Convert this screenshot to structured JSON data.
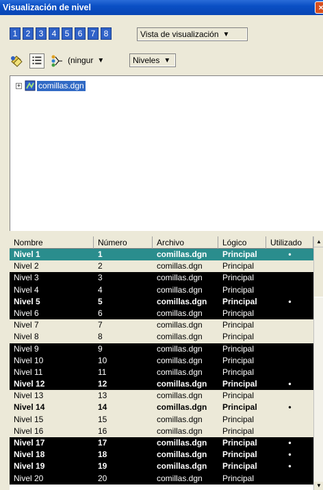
{
  "window": {
    "title": "Visualización de nivel",
    "close_glyph": "×"
  },
  "toolbar1": {
    "view_numbers": [
      "1",
      "2",
      "3",
      "4",
      "5",
      "6",
      "7",
      "8"
    ],
    "view_dropdown": "Vista de visualización"
  },
  "toolbar2": {
    "icons": [
      "level-manager-icon",
      "list-view-icon",
      "filter-icon"
    ],
    "filter_dropdown": "(ningur",
    "levels_dropdown": "Niveles"
  },
  "tree": {
    "file": "comillas.dgn"
  },
  "table": {
    "columns": [
      "Nombre",
      "Número",
      "Archivo",
      "Lógico",
      "Utilizado"
    ],
    "rows": [
      {
        "name": "Nivel 1",
        "num": "1",
        "file": "comillas.dgn",
        "logic": "Principal",
        "used": "•",
        "style": "teal",
        "bold": true
      },
      {
        "name": "Nivel 2",
        "num": "2",
        "file": "comillas.dgn",
        "logic": "Principal",
        "used": "",
        "style": "light",
        "bold": false
      },
      {
        "name": "Nivel 3",
        "num": "3",
        "file": "comillas.dgn",
        "logic": "Principal",
        "used": "",
        "style": "dark",
        "bold": false
      },
      {
        "name": "Nivel 4",
        "num": "4",
        "file": "comillas.dgn",
        "logic": "Principal",
        "used": "",
        "style": "dark",
        "bold": false
      },
      {
        "name": "Nivel 5",
        "num": "5",
        "file": "comillas.dgn",
        "logic": "Principal",
        "used": "•",
        "style": "dark",
        "bold": true
      },
      {
        "name": "Nivel 6",
        "num": "6",
        "file": "comillas.dgn",
        "logic": "Principal",
        "used": "",
        "style": "dark",
        "bold": false
      },
      {
        "name": "Nivel 7",
        "num": "7",
        "file": "comillas.dgn",
        "logic": "Principal",
        "used": "",
        "style": "light",
        "bold": false
      },
      {
        "name": "Nivel 8",
        "num": "8",
        "file": "comillas.dgn",
        "logic": "Principal",
        "used": "",
        "style": "light",
        "bold": false
      },
      {
        "name": "Nivel 9",
        "num": "9",
        "file": "comillas.dgn",
        "logic": "Principal",
        "used": "",
        "style": "dark",
        "bold": false
      },
      {
        "name": "Nivel 10",
        "num": "10",
        "file": "comillas.dgn",
        "logic": "Principal",
        "used": "",
        "style": "dark",
        "bold": false
      },
      {
        "name": "Nivel 11",
        "num": "11",
        "file": "comillas.dgn",
        "logic": "Principal",
        "used": "",
        "style": "dark",
        "bold": false
      },
      {
        "name": "Nivel 12",
        "num": "12",
        "file": "comillas.dgn",
        "logic": "Principal",
        "used": "•",
        "style": "dark",
        "bold": true
      },
      {
        "name": "Nivel 13",
        "num": "13",
        "file": "comillas.dgn",
        "logic": "Principal",
        "used": "",
        "style": "light",
        "bold": false
      },
      {
        "name": "Nivel 14",
        "num": "14",
        "file": "comillas.dgn",
        "logic": "Principal",
        "used": "•",
        "style": "light",
        "bold": true
      },
      {
        "name": "Nivel 15",
        "num": "15",
        "file": "comillas.dgn",
        "logic": "Principal",
        "used": "",
        "style": "light",
        "bold": false
      },
      {
        "name": "Nivel 16",
        "num": "16",
        "file": "comillas.dgn",
        "logic": "Principal",
        "used": "",
        "style": "light",
        "bold": false
      },
      {
        "name": "Nivel 17",
        "num": "17",
        "file": "comillas.dgn",
        "logic": "Principal",
        "used": "•",
        "style": "dark",
        "bold": true
      },
      {
        "name": "Nivel 18",
        "num": "18",
        "file": "comillas.dgn",
        "logic": "Principal",
        "used": "•",
        "style": "dark",
        "bold": true
      },
      {
        "name": "Nivel 19",
        "num": "19",
        "file": "comillas.dgn",
        "logic": "Principal",
        "used": "•",
        "style": "dark",
        "bold": true
      },
      {
        "name": "Nivel 20",
        "num": "20",
        "file": "comillas.dgn",
        "logic": "Principal",
        "used": "",
        "style": "dark",
        "bold": false
      }
    ]
  }
}
